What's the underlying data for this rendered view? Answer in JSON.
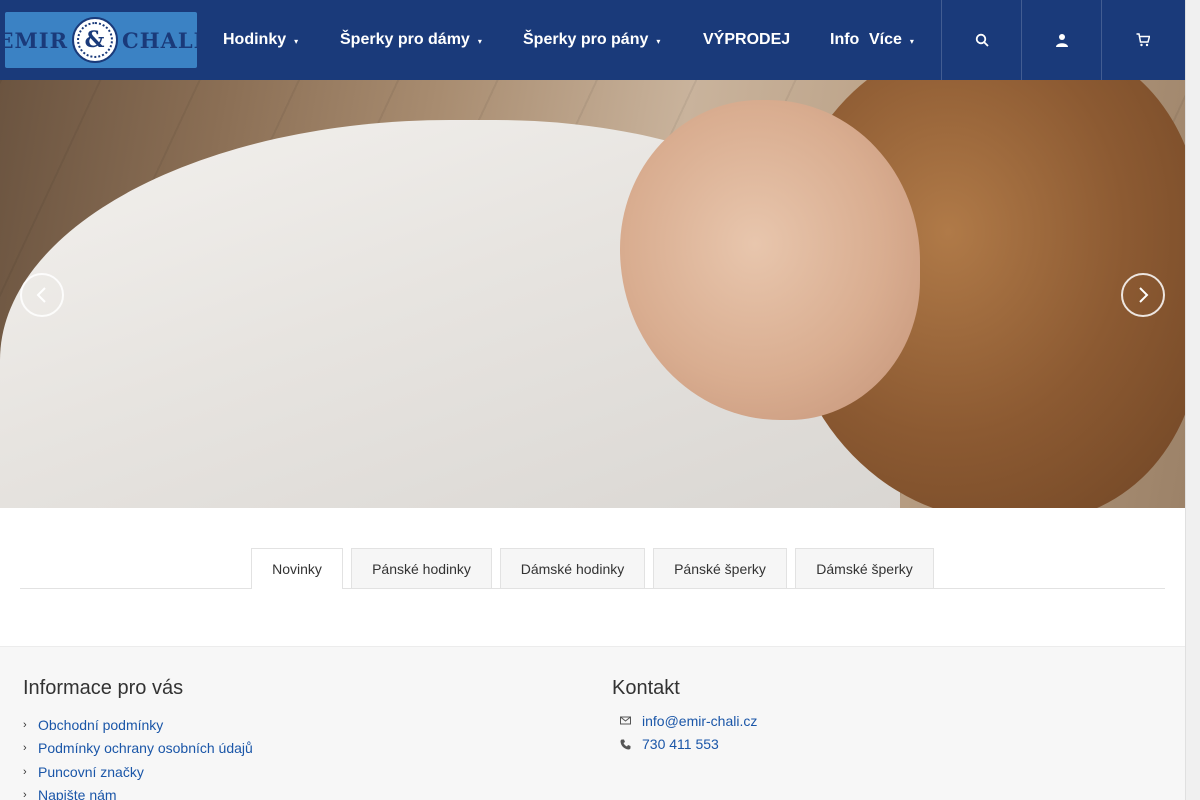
{
  "brand": {
    "logo_left": "EMIR",
    "logo_amp": "&",
    "logo_right": "CHALI"
  },
  "nav": {
    "hodinky": "Hodinky",
    "sperky_damy": "Šperky pro dámy",
    "sperky_pany": "Šperky pro pány",
    "vyprodej": "VÝPRODEJ",
    "info": "Info",
    "vice": "Více"
  },
  "header_icons": [
    "search-icon",
    "user-icon",
    "cart-icon"
  ],
  "hero": {
    "image": "hero-banner-woman-white-shirt"
  },
  "tabs": [
    "Novinky",
    "Pánské hodinky",
    "Dámské hodinky",
    "Pánské šperky",
    "Dámské šperky"
  ],
  "active_tab": "Novinky",
  "footer": {
    "info_title": "Informace pro vás",
    "links": [
      "Obchodní podmínky",
      "Podmínky ochrany osobních údajů",
      "Puncovní značky",
      "Napište nám"
    ],
    "contact_title": "Kontakt",
    "email": "info@emir-chali.cz",
    "phone": "730 411 553"
  },
  "colors": {
    "header_bg": "#1a3a7a",
    "logo_bg": "#3b82c4",
    "link": "#1a56a8",
    "footer_bg": "#f7f7f7"
  }
}
